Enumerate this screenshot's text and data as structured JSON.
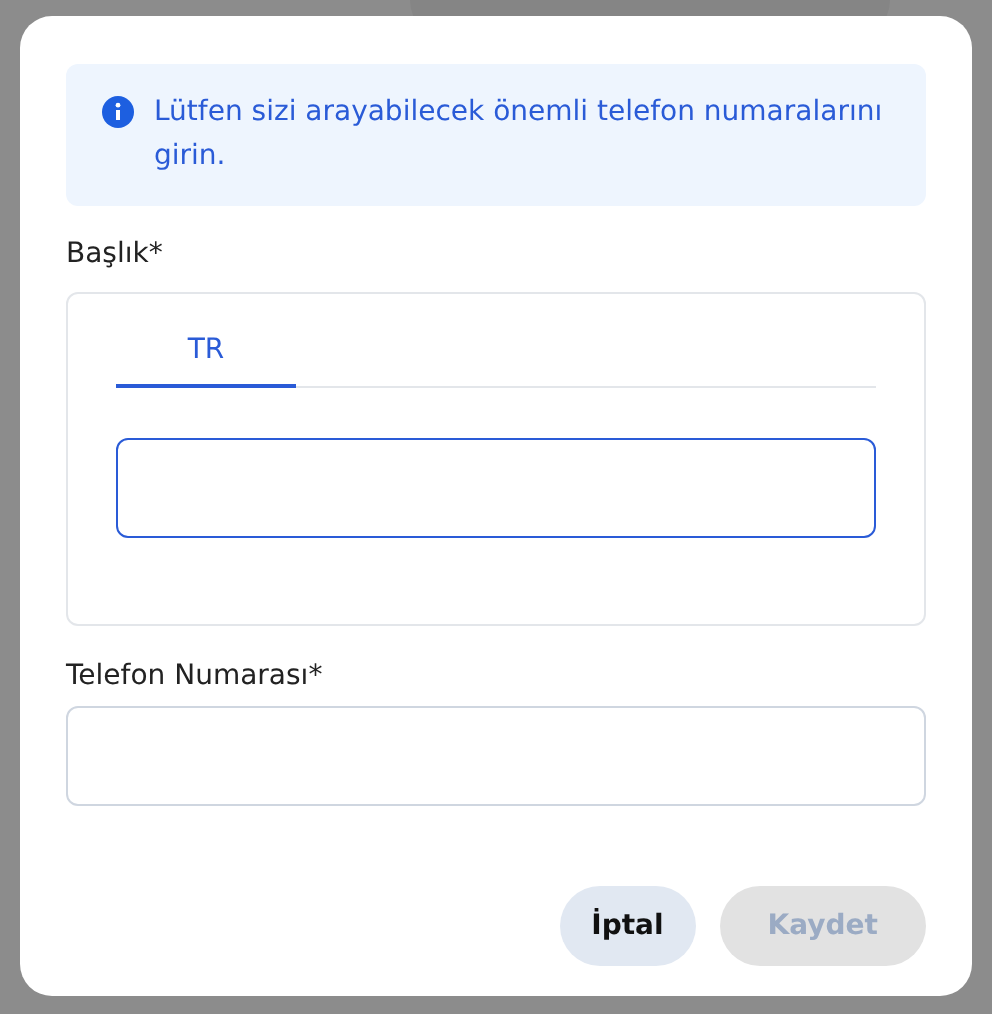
{
  "dialog": {
    "info": "Lütfen sizi arayabilecek önemli telefon numaralarını girin.",
    "title_field": {
      "label": "Başlık*",
      "tabs": [
        {
          "label": "TR",
          "selected": true
        }
      ]
    },
    "phone_field": {
      "label": "Telefon Numarası*"
    },
    "buttons": [
      {
        "label": "İptal",
        "disabled": false
      },
      {
        "label": "Kaydet",
        "disabled": true
      }
    ]
  }
}
